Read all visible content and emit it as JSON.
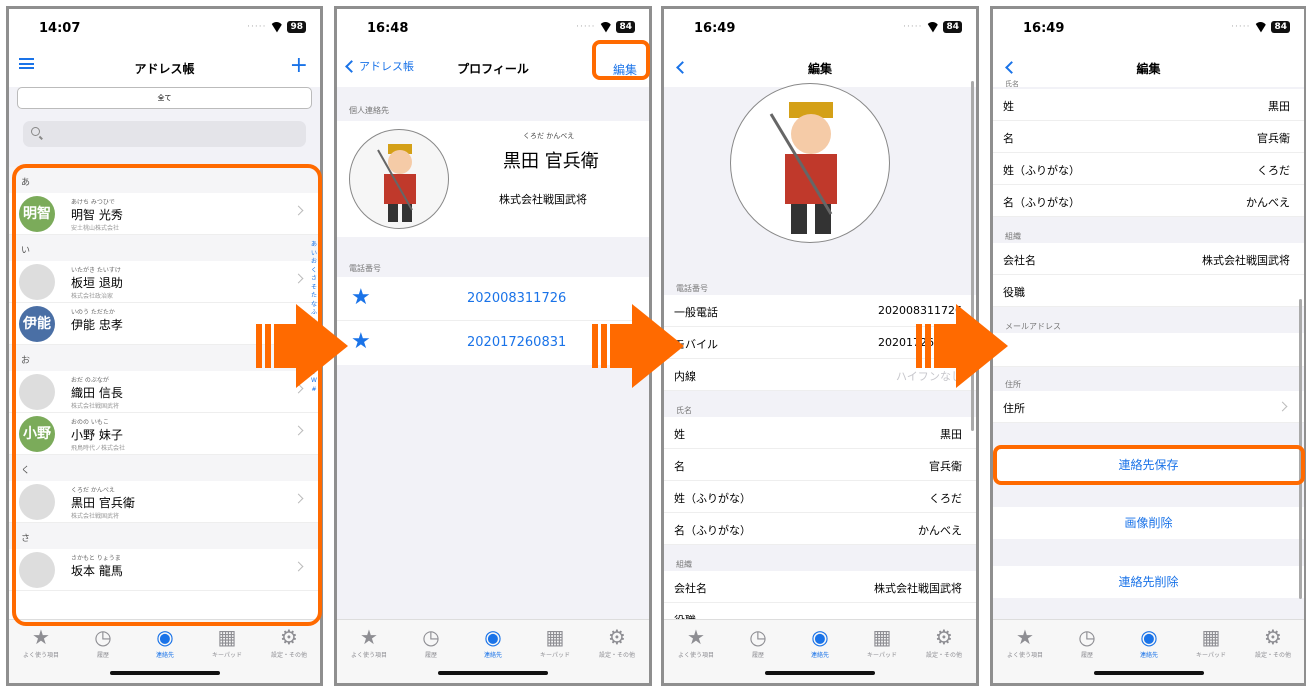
{
  "screens": [
    {
      "time": "14:07",
      "battery": "98",
      "nav_title": "アドレス帳",
      "add_label": "+",
      "segment_label": "全て",
      "sections": [
        {
          "header": "あ",
          "rows": [
            {
              "ruby": "あけち みつひで",
              "name": "明智 光秀",
              "company": "安土桃山株式会社",
              "avatar_text": "明智",
              "avatar_color": "#7bab5a"
            }
          ]
        },
        {
          "header": "い",
          "rows": [
            {
              "ruby": "いたがき たいすけ",
              "name": "板垣 退助",
              "company": "株式会社政治家",
              "avatar_text": "",
              "avatar_color": "#dddddd"
            },
            {
              "ruby": "いのう ただたか",
              "name": "伊能 忠孝",
              "company": "",
              "avatar_text": "伊能",
              "avatar_color": "#4a6fa5"
            }
          ]
        },
        {
          "header": "お",
          "rows": [
            {
              "ruby": "おだ のぶなが",
              "name": "織田 信長",
              "company": "株式会社戦国武将",
              "avatar_text": "",
              "avatar_color": "#dddddd"
            },
            {
              "ruby": "おのの いもこ",
              "name": "小野 妹子",
              "company": "飛鳥時代ノ株式会社",
              "avatar_text": "小野",
              "avatar_color": "#7bab5a"
            }
          ]
        },
        {
          "header": "く",
          "rows": [
            {
              "ruby": "くろだ かんべえ",
              "name": "黒田 官兵衛",
              "company": "株式会社戦国武将",
              "avatar_text": "",
              "avatar_color": "#dddddd"
            }
          ]
        },
        {
          "header": "さ",
          "rows": [
            {
              "ruby": "さかもと りょうま",
              "name": "坂本 龍馬",
              "company": "",
              "avatar_text": "",
              "avatar_color": "#dddddd"
            }
          ]
        }
      ],
      "index_letters": [
        "あ",
        "い",
        "お",
        "く",
        "さ",
        "そ",
        "た",
        "な",
        "ふ",
        "A",
        "B",
        "C",
        "D",
        "F",
        "M",
        "T",
        "W",
        "#"
      ]
    },
    {
      "time": "16:48",
      "battery": "84",
      "back_label": "アドレス帳",
      "nav_title": "プロフィール",
      "edit_label": "編集",
      "section_personal": "個人連絡先",
      "ruby": "くろだ かんべえ",
      "name": "黒田 官兵衛",
      "company": "株式会社戦国武将",
      "section_phone": "電話番号",
      "phones": [
        "202008311726",
        "202017260831"
      ]
    },
    {
      "time": "16:49",
      "battery": "84",
      "nav_title": "編集",
      "section_phone": "電話番号",
      "phone_rows": [
        {
          "label": "一般電話",
          "value": "202008311726"
        },
        {
          "label": "モバイル",
          "value": "202017260831"
        },
        {
          "label": "内線",
          "value": "ハイフンなし"
        }
      ],
      "section_name": "氏名",
      "name_rows": [
        {
          "label": "姓",
          "value": "黒田"
        },
        {
          "label": "名",
          "value": "官兵衛"
        },
        {
          "label": "姓（ふりがな）",
          "value": "くろだ"
        },
        {
          "label": "名（ふりがな）",
          "value": "かんべえ"
        }
      ],
      "section_org": "組織",
      "org_rows": [
        {
          "label": "会社名",
          "value": "株式会社戦国武将"
        },
        {
          "label": "役職",
          "value": ""
        }
      ]
    },
    {
      "time": "16:49",
      "battery": "84",
      "nav_title": "編集",
      "section_name": "氏名",
      "name_rows": [
        {
          "label": "姓",
          "value": "黒田"
        },
        {
          "label": "名",
          "value": "官兵衛"
        },
        {
          "label": "姓（ふりがな）",
          "value": "くろだ"
        },
        {
          "label": "名（ふりがな）",
          "value": "かんべえ"
        }
      ],
      "section_org": "組織",
      "org_rows": [
        {
          "label": "会社名",
          "value": "株式会社戦国武将"
        },
        {
          "label": "役職",
          "value": ""
        }
      ],
      "section_mail": "メールアドレス",
      "section_address": "住所",
      "address_label": "住所",
      "save_label": "連絡先保存",
      "delete_image_label": "画像削除",
      "delete_contact_label": "連絡先削除"
    }
  ],
  "tabs": [
    {
      "label": "よく使う項目",
      "icon": "star-icon",
      "glyph": "★"
    },
    {
      "label": "履歴",
      "icon": "clock-icon",
      "glyph": "◷"
    },
    {
      "label": "連絡先",
      "icon": "person-circle-icon",
      "glyph": "◉"
    },
    {
      "label": "キーパッド",
      "icon": "keypad-icon",
      "glyph": "▦"
    },
    {
      "label": "設定・その他",
      "icon": "gear-icon",
      "glyph": "⚙"
    }
  ],
  "colors": {
    "accent": "#1a73e8",
    "highlight": "#ff6a00",
    "background": "#f2f2f7"
  }
}
